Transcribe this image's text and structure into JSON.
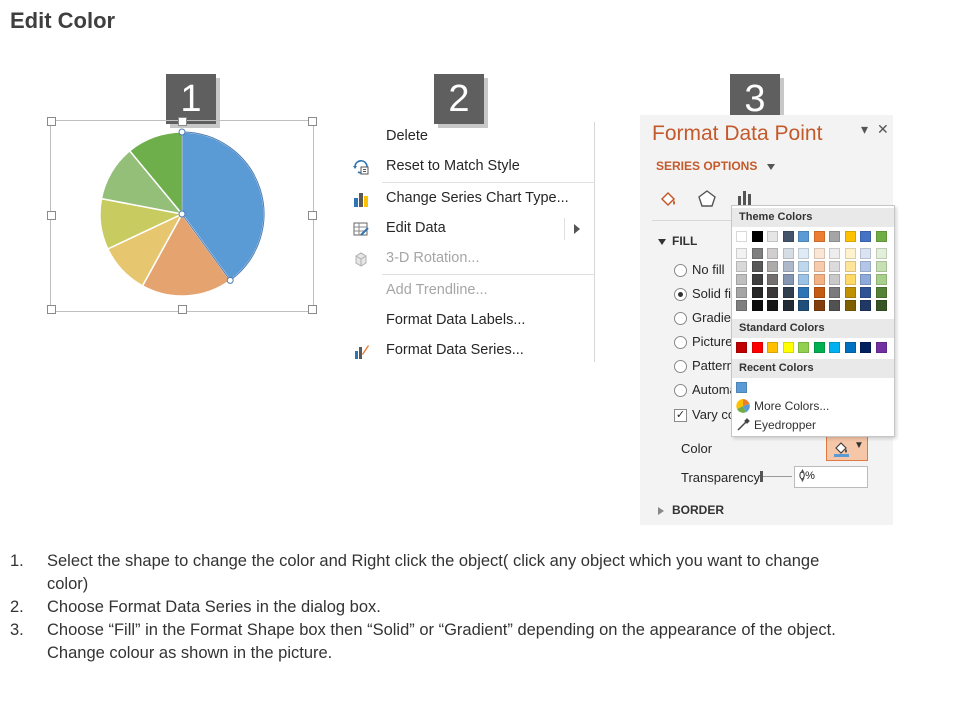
{
  "page": {
    "title": "Edit Color"
  },
  "steps": [
    "1",
    "2",
    "3"
  ],
  "chart_data": {
    "type": "pie",
    "title": "",
    "slices": [
      {
        "value": 40,
        "color": "#5b9bd5"
      },
      {
        "value": 18,
        "color": "#e5a46f"
      },
      {
        "value": 10,
        "color": "#e6c770"
      },
      {
        "value": 10,
        "color": "#c8cb5f"
      },
      {
        "value": 11,
        "color": "#93bf79"
      },
      {
        "value": 11,
        "color": "#6eae4b"
      }
    ]
  },
  "context_menu": {
    "items": [
      {
        "label": "Delete",
        "icon": "none",
        "disabled": false
      },
      {
        "label": "Reset to Match Style",
        "icon": "reset-style-icon",
        "disabled": false
      },
      {
        "label": "Change Series Chart Type...",
        "icon": "bar-chart-icon",
        "disabled": false
      },
      {
        "label": "Edit Data",
        "icon": "edit-data-icon",
        "disabled": false,
        "submenu": true
      },
      {
        "label": "3-D Rotation...",
        "icon": "cube-icon",
        "disabled": true
      },
      {
        "label": "Add Trendline...",
        "icon": "none",
        "disabled": true
      },
      {
        "label": "Format Data Labels...",
        "icon": "none",
        "disabled": false
      },
      {
        "label": "Format Data Series...",
        "icon": "format-series-icon",
        "disabled": false
      }
    ]
  },
  "format_pane": {
    "title": "Format Data Point",
    "series_options": "SERIES OPTIONS",
    "fill_header": "FILL",
    "fill_options": [
      {
        "label": "No fill",
        "type": "radio",
        "selected": false
      },
      {
        "label": "Solid fi",
        "type": "radio",
        "selected": true
      },
      {
        "label": "Gradier",
        "type": "radio",
        "selected": false
      },
      {
        "label": "Picture",
        "type": "radio",
        "selected": false
      },
      {
        "label": "Pattern",
        "type": "radio",
        "selected": false
      },
      {
        "label": "Automa",
        "type": "radio",
        "selected": false
      },
      {
        "label": "Vary co",
        "type": "checkbox",
        "selected": true
      }
    ],
    "color_label": "Color",
    "transparency_label": "Transparency",
    "transparency_value": "0%",
    "border_header": "BORDER",
    "accent": "#c45a2b"
  },
  "color_picker": {
    "theme_colors_label": "Theme Colors",
    "standard_colors_label": "Standard Colors",
    "recent_colors_label": "Recent Colors",
    "more_colors": "More Colors...",
    "eyedropper": "Eyedropper",
    "theme_top": [
      "#ffffff",
      "#000000",
      "#e7e6e6",
      "#44546a",
      "#5b9bd5",
      "#ed7d31",
      "#a5a5a5",
      "#ffc000",
      "#4472c4",
      "#70ad47"
    ],
    "theme_shades": [
      [
        "#f2f2f2",
        "#7f7f7f",
        "#d0cece",
        "#d6dce4",
        "#deebf6",
        "#fbe5d5",
        "#ededed",
        "#fff2cc",
        "#dae3f3",
        "#e2efd9"
      ],
      [
        "#d8d8d8",
        "#595959",
        "#aeabab",
        "#adb9ca",
        "#bdd7ee",
        "#f7cbac",
        "#dbdbdb",
        "#fee599",
        "#b4c6e7",
        "#c5e0b3"
      ],
      [
        "#bfbfbf",
        "#3f3f3f",
        "#757070",
        "#8496b0",
        "#9cc3e5",
        "#f4b183",
        "#c9c9c9",
        "#ffd965",
        "#8eaadb",
        "#a8d08d"
      ],
      [
        "#a5a5a5",
        "#262626",
        "#3a3838",
        "#323f4f",
        "#2e75b5",
        "#c55a11",
        "#7b7b7b",
        "#bf9000",
        "#2f5496",
        "#538135"
      ],
      [
        "#7f7f7f",
        "#0c0c0c",
        "#171616",
        "#222a35",
        "#1e4e79",
        "#833c0b",
        "#525252",
        "#7f6000",
        "#1f3864",
        "#375623"
      ]
    ],
    "standard": [
      "#c00000",
      "#ff0000",
      "#ffc000",
      "#ffff00",
      "#92d050",
      "#00b050",
      "#00b0f0",
      "#0070c0",
      "#002060",
      "#7030a0"
    ],
    "recent": [
      "#5b9bd5"
    ]
  },
  "instructions": [
    {
      "num": "1.",
      "line1": "Select the shape to change the color and Right click the object( click any object which you want to change",
      "line2": "color)"
    },
    {
      "num": "2.",
      "line1": "Choose Format Data Series in the dialog box.",
      "line2": ""
    },
    {
      "num": "3.",
      "line1": "Choose “Fill” in the Format Shape box then  “Solid” or “Gradient” depending on the appearance of the object.",
      "line2": "Change colour as shown in the picture."
    }
  ]
}
